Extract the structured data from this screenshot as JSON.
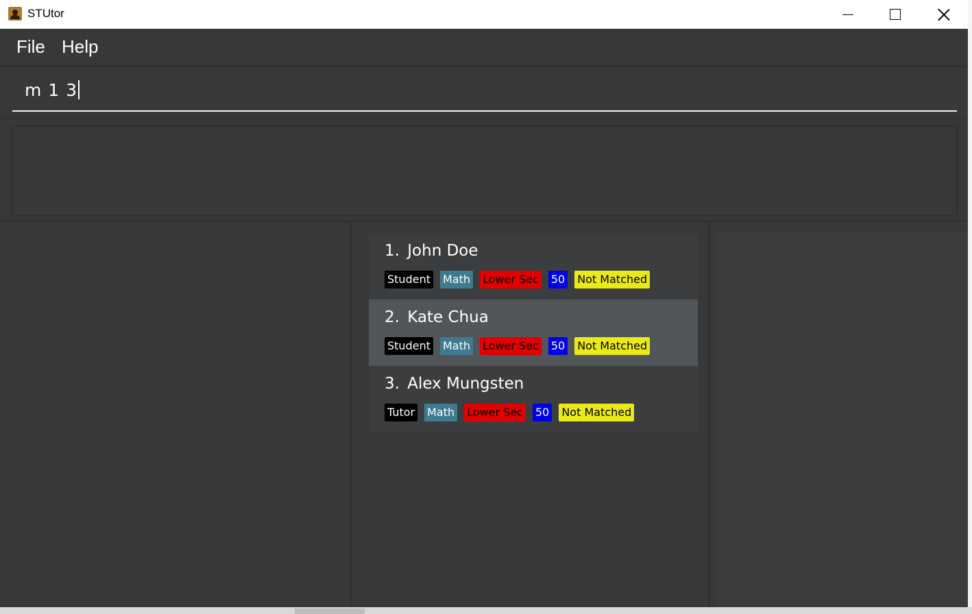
{
  "window": {
    "title": "STUtor",
    "minimize_icon": "minimize-icon",
    "maximize_icon": "maximize-icon",
    "close_icon": "close-icon"
  },
  "menu": {
    "file_label": "File",
    "help_label": "Help"
  },
  "command": {
    "value": "m 1 3"
  },
  "result": {
    "text": ""
  },
  "people": [
    {
      "index": "1.",
      "name": "John Doe",
      "role": "Student",
      "subject": "Math",
      "level": "Lower Sec",
      "price": "50",
      "status": "Not Matched"
    },
    {
      "index": "2.",
      "name": "Kate Chua",
      "role": "Student",
      "subject": "Math",
      "level": "Lower Sec",
      "price": "50",
      "status": "Not Matched",
      "selected": true
    },
    {
      "index": "3.",
      "name": "Alex Mungsten",
      "role": "Tutor",
      "subject": "Math",
      "level": "Lower Sec",
      "price": "50",
      "status": "Not Matched"
    }
  ],
  "colors": {
    "background": "#383838",
    "card": "#3c3d3f",
    "card_selected": "#525659",
    "tag_role": "#000000",
    "tag_subject": "#3e7b91",
    "tag_level": "#e20000",
    "tag_price": "#0000e8",
    "tag_status": "#eaea18"
  }
}
